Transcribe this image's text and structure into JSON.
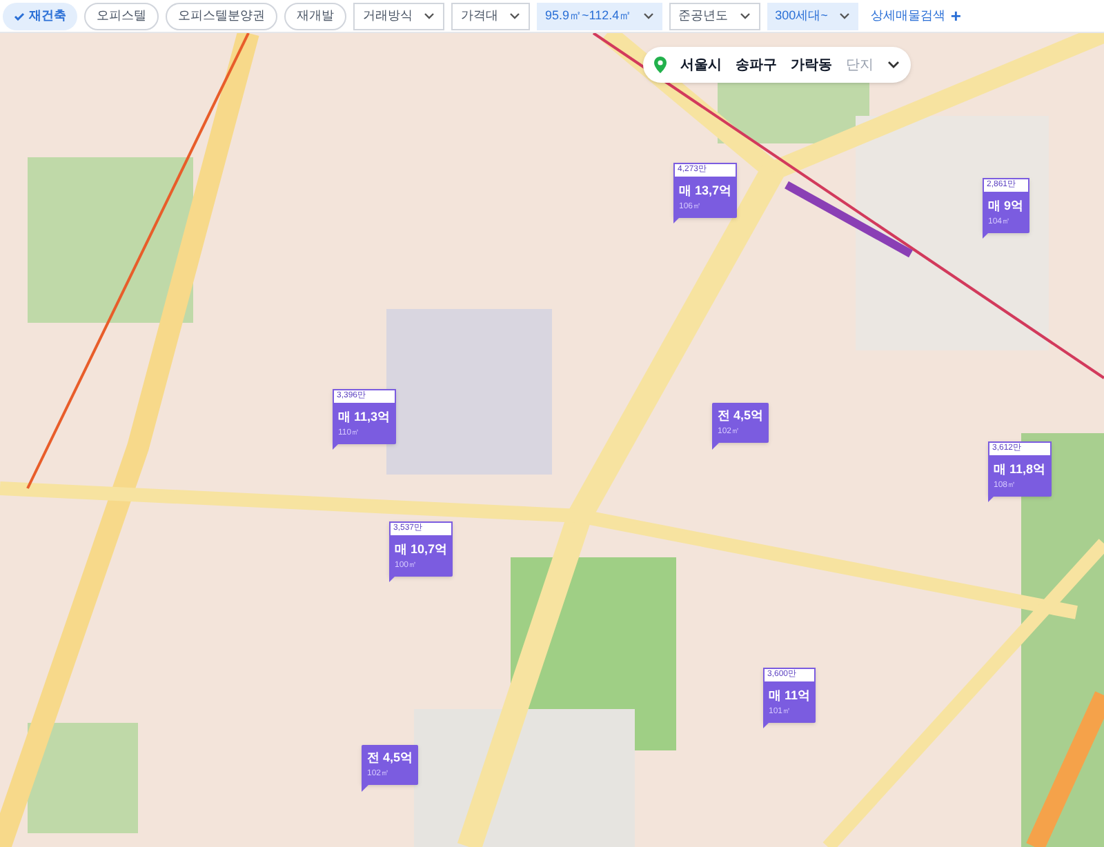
{
  "filters": [
    {
      "kind": "chip",
      "label": "재건축",
      "selected": true
    },
    {
      "kind": "chip",
      "label": "오피스텔",
      "selected": false
    },
    {
      "kind": "chip",
      "label": "오피스텔분양권",
      "selected": false
    },
    {
      "kind": "chip",
      "label": "재개발",
      "selected": false
    },
    {
      "kind": "dropdown",
      "label": "거래방식",
      "selected": false
    },
    {
      "kind": "dropdown",
      "label": "가격대",
      "selected": false
    },
    {
      "kind": "dropdown",
      "label": "95.9㎡~112.4㎡",
      "selected": true
    },
    {
      "kind": "dropdown",
      "label": "준공년도",
      "selected": false
    },
    {
      "kind": "dropdown",
      "label": "300세대~",
      "selected": true
    }
  ],
  "detail_search": {
    "label": "상세매물검색",
    "icon": "+"
  },
  "breadcrumb": {
    "items": [
      {
        "label": "서울시",
        "selected": true
      },
      {
        "label": "송파구",
        "selected": true
      },
      {
        "label": "가락동",
        "selected": true
      },
      {
        "label": "단지",
        "selected": false
      }
    ]
  },
  "markers": [
    {
      "unit_price": "4,273만",
      "price": "매 13,7억",
      "area": "106㎡"
    },
    {
      "unit_price": "2,861만",
      "price": "매 9억",
      "area": "104㎡"
    },
    {
      "unit_price": "3,396만",
      "price": "매 11,3억",
      "area": "110㎡"
    },
    {
      "price": "전 4,5억",
      "area": "102㎡"
    },
    {
      "unit_price": "3,537만",
      "price": "매 10,7억",
      "area": "100㎡"
    },
    {
      "unit_price": "3,612만",
      "price": "매 11,8억",
      "area": "108㎡"
    },
    {
      "unit_price": "3,600만",
      "price": "매 11억",
      "area": "101㎡"
    },
    {
      "price": "전 4,5억",
      "area": "102㎡"
    }
  ]
}
